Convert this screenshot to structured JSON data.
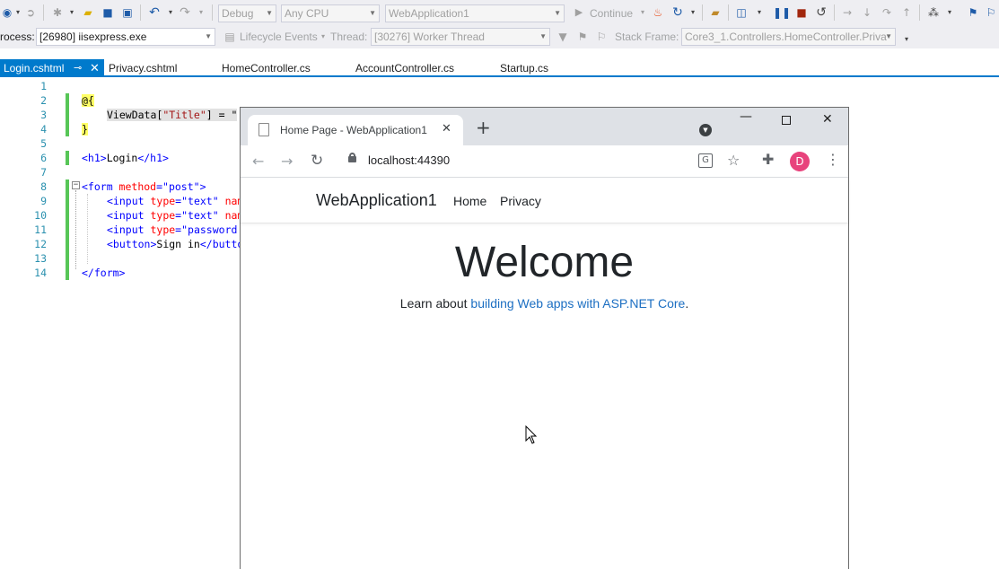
{
  "toolbar": {
    "config": "Debug",
    "platform": "Any CPU",
    "startup_project": "WebApplication1",
    "continue_label": "Continue"
  },
  "debug_bar": {
    "process_label": "rocess:",
    "process_value": "[26980] iisexpress.exe",
    "lifecycle_label": "Lifecycle Events",
    "thread_label": "Thread:",
    "thread_value": "[30276] Worker Thread",
    "stack_label": "Stack Frame:",
    "stack_value": "Core3_1.Controllers.HomeController.Priva"
  },
  "tabs": [
    {
      "label": "Login.cshtml",
      "active": true
    },
    {
      "label": "Privacy.cshtml"
    },
    {
      "label": "HomeController.cs"
    },
    {
      "label": "AccountController.cs"
    },
    {
      "label": "Startup.cs"
    }
  ],
  "code": {
    "line_numbers": [
      "1",
      "2",
      "3",
      "4",
      "5",
      "6",
      "7",
      "8",
      "9",
      "10",
      "11",
      "12",
      "13",
      "14"
    ],
    "l2_razor": "@{",
    "l3_a": "ViewData[",
    "l3_b": "\"Title\"",
    "l3_c": "] = \"",
    "l4_brace": "}",
    "l6_open": "<h1>",
    "l6_text": "Login",
    "l6_close": "</h1>",
    "l8_open": "<form ",
    "l8_attr": "method",
    "l8_eq": "=",
    "l8_val": "\"post\"",
    "l8_close": ">",
    "l9_a": "<input ",
    "l9_attr": "type",
    "l9_eq": "=",
    "l9_val": "\"text\"",
    "l9_tail": " nam",
    "l10_a": "<input ",
    "l10_attr": "type",
    "l10_eq": "=",
    "l10_val": "\"text\"",
    "l10_tail": " nam",
    "l11_a": "<input ",
    "l11_attr": "type",
    "l11_eq": "=",
    "l11_val": "\"password",
    "l12_open": "<button>",
    "l12_text": "Sign in",
    "l12_close": "</butto",
    "l14_close": "</form>"
  },
  "browser": {
    "tab_title": "Home Page - WebApplication1",
    "url": "localhost:44390",
    "profile_initial": "D",
    "brand": "WebApplication1",
    "nav": [
      "Home",
      "Privacy"
    ],
    "heading": "Welcome",
    "learn_prefix": "Learn about ",
    "learn_link": "building Web apps with ASP.NET Core",
    "learn_suffix": "."
  },
  "colors": {
    "accent": "#007acc",
    "link": "#1b6ec2",
    "profile": "#e8437c",
    "change_marker": "#57c657"
  }
}
